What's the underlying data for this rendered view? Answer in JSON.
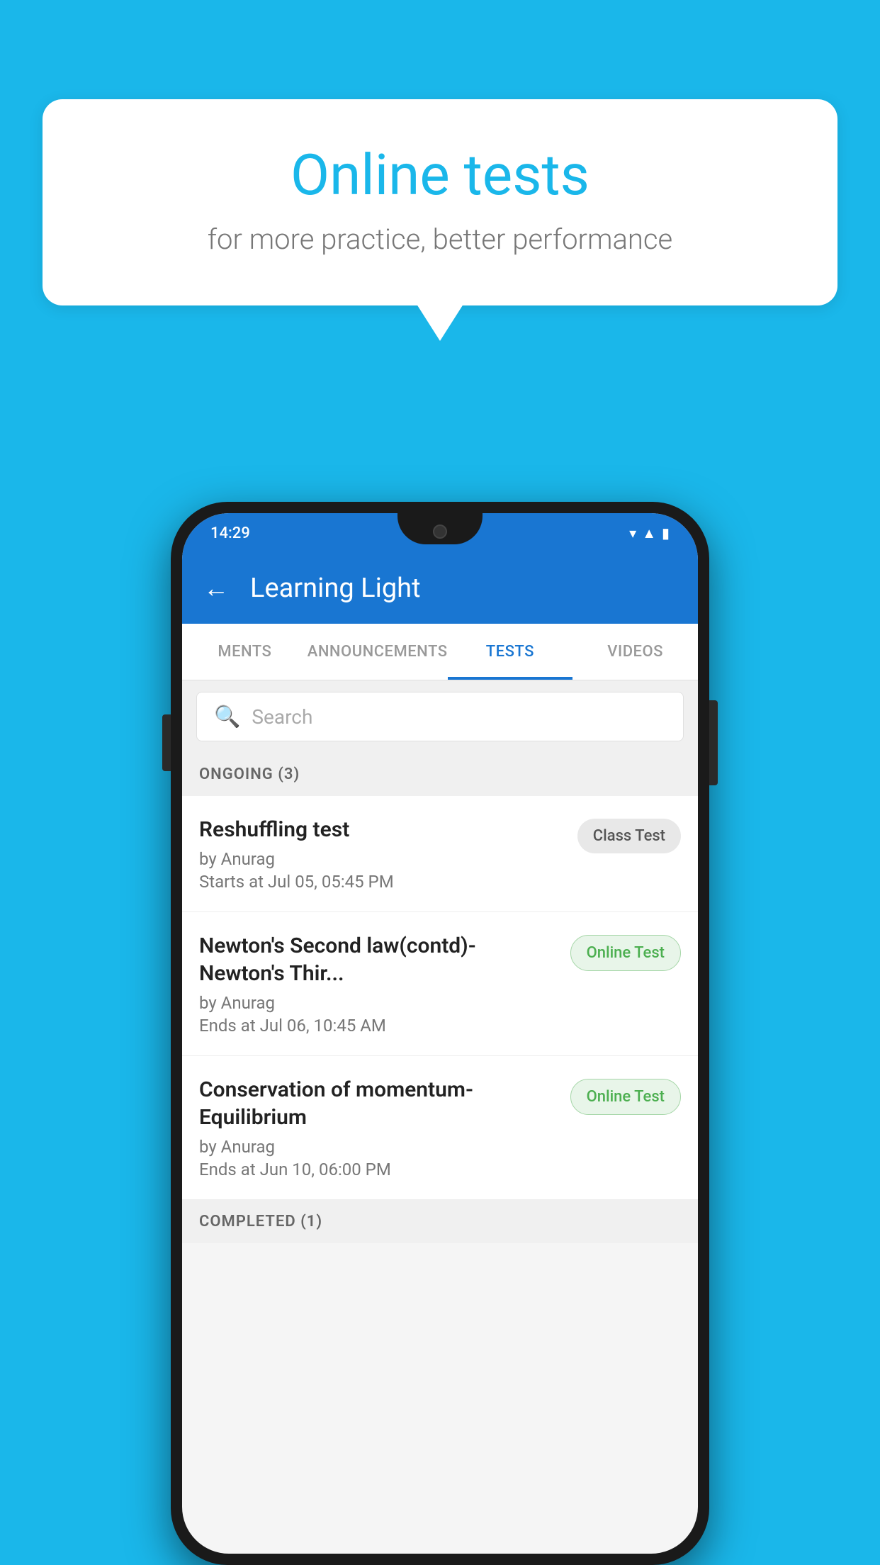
{
  "background": {
    "color": "#1ab7ea"
  },
  "speech_bubble": {
    "title": "Online tests",
    "subtitle": "for more practice, better performance"
  },
  "phone": {
    "status_bar": {
      "time": "14:29",
      "icons": [
        "wifi",
        "signal",
        "battery"
      ]
    },
    "app_bar": {
      "back_label": "←",
      "title": "Learning Light"
    },
    "tabs": [
      {
        "label": "MENTS",
        "active": false
      },
      {
        "label": "ANNOUNCEMENTS",
        "active": false
      },
      {
        "label": "TESTS",
        "active": true
      },
      {
        "label": "VIDEOS",
        "active": false
      }
    ],
    "search": {
      "placeholder": "Search"
    },
    "sections": [
      {
        "header": "ONGOING (3)",
        "tests": [
          {
            "title": "Reshuffling test",
            "author": "by Anurag",
            "date": "Starts at  Jul 05, 05:45 PM",
            "badge": "Class Test",
            "badge_type": "class"
          },
          {
            "title": "Newton's Second law(contd)-Newton's Thir...",
            "author": "by Anurag",
            "date": "Ends at  Jul 06, 10:45 AM",
            "badge": "Online Test",
            "badge_type": "online"
          },
          {
            "title": "Conservation of momentum-Equilibrium",
            "author": "by Anurag",
            "date": "Ends at  Jun 10, 06:00 PM",
            "badge": "Online Test",
            "badge_type": "online"
          }
        ]
      }
    ],
    "completed_section_header": "COMPLETED (1)"
  }
}
